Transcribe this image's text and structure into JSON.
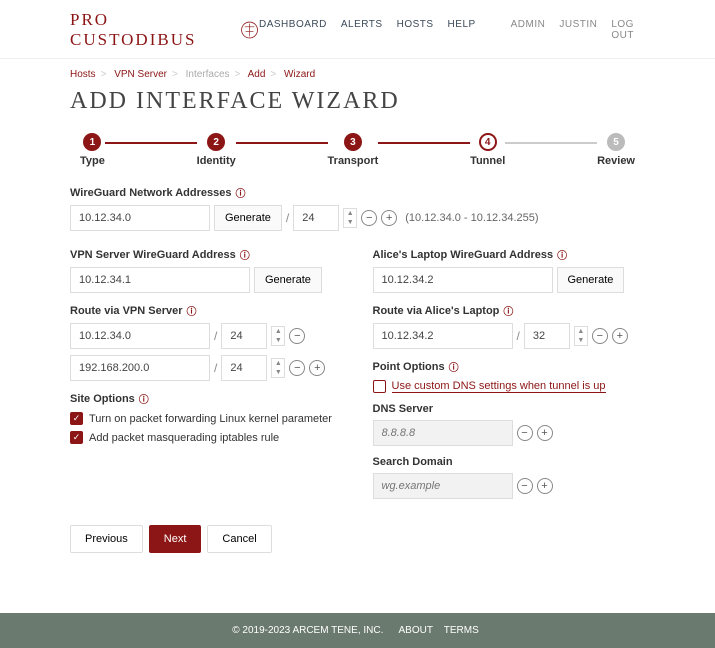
{
  "brand": "PRO CUSTODIBUS",
  "nav": {
    "dashboard": "DASHBOARD",
    "alerts": "ALERTS",
    "hosts": "HOSTS",
    "help": "HELP",
    "admin": "ADMIN",
    "user": "JUSTIN",
    "logout": "LOG OUT"
  },
  "crumbs": {
    "hosts": "Hosts",
    "vpn": "VPN Server",
    "interfaces": "Interfaces",
    "add": "Add",
    "wizard": "Wizard"
  },
  "title": "ADD INTERFACE WIZARD",
  "steps": {
    "s1": "Type",
    "s2": "Identity",
    "s3": "Transport",
    "s4": "Tunnel",
    "s5": "Review"
  },
  "labels": {
    "network_addresses": "WireGuard Network Addresses",
    "vpn_address": "VPN Server WireGuard Address",
    "route_vpn": "Route via VPN Server",
    "site_options": "Site Options",
    "laptop_address": "Alice's Laptop WireGuard Address",
    "route_laptop": "Route via Alice's Laptop",
    "point_options": "Point Options",
    "dns_server": "DNS Server",
    "search_domain": "Search Domain",
    "generate": "Generate"
  },
  "values": {
    "network_addr": "10.12.34.0",
    "network_mask": "24",
    "network_range": "(10.12.34.0 - 10.12.34.255)",
    "vpn_addr": "10.12.34.1",
    "route_vpn1": "10.12.34.0",
    "route_vpn1_mask": "24",
    "route_vpn2": "192.168.200.0",
    "route_vpn2_mask": "24",
    "laptop_addr": "10.12.34.2",
    "route_laptop": "10.12.34.2",
    "route_laptop_mask": "32",
    "dns_placeholder": "8.8.8.8",
    "search_placeholder": "wg.example"
  },
  "checkboxes": {
    "pkt_fwd": "Turn on packet forwarding Linux kernel parameter",
    "masq": "Add packet masquerading iptables rule",
    "custom_dns": "Use custom DNS settings when tunnel is up"
  },
  "buttons": {
    "previous": "Previous",
    "next": "Next",
    "cancel": "Cancel"
  },
  "footer": {
    "copyright": "© 2019-2023  ARCEM TENE, INC.",
    "about": "ABOUT",
    "terms": "TERMS"
  }
}
